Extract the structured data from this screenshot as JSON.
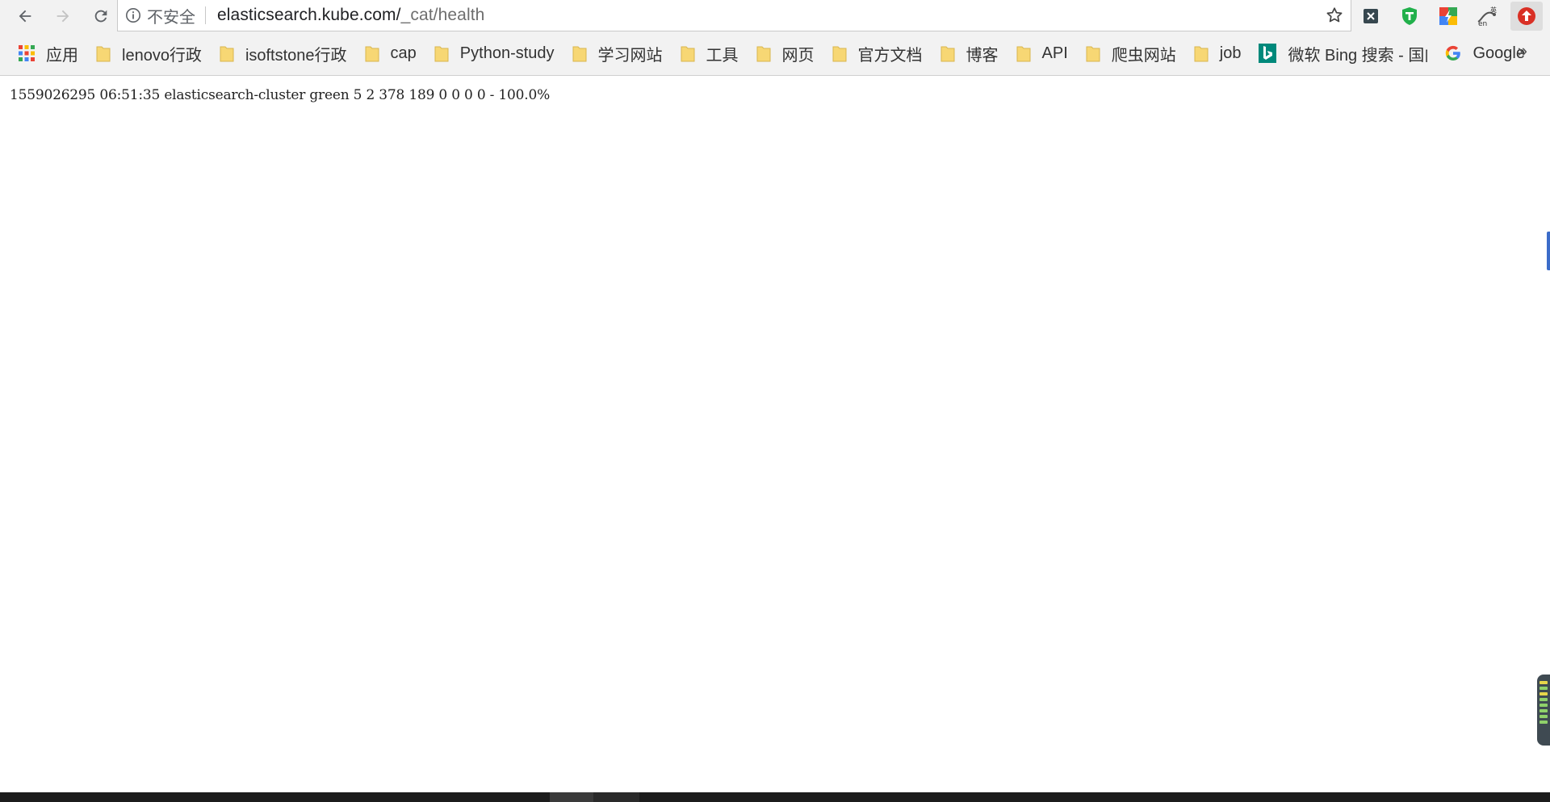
{
  "browser": {
    "security_label": "不安全",
    "url_host": "elasticsearch.kube.com/",
    "url_path": "_cat/health"
  },
  "extensions": [
    {
      "name": "x-extension-icon"
    },
    {
      "name": "t-shield-extension-icon"
    },
    {
      "name": "colorful-extension-icon"
    },
    {
      "name": "translate-en-extension-icon"
    },
    {
      "name": "upload-extension-icon"
    }
  ],
  "bookmarks": {
    "apps_label": "应用",
    "items": [
      "lenovo行政",
      "isoftstone行政",
      "cap",
      "Python-study",
      "学习网站",
      "工具",
      "网页",
      "官方文档",
      "博客",
      "API",
      "爬虫网站",
      "job"
    ],
    "bing_label": "微软 Bing 搜索 - 国内版",
    "google_label": "Google",
    "more_label": "»"
  },
  "content": {
    "health_line": "1559026295 06:51:35 elasticsearch-cluster green 5 2 378 189 0 0 0 0 - 100.0%"
  },
  "colors": {
    "folder": "#f7d774",
    "toolbar_bg": "#f2f2f2",
    "bing": "#00897b",
    "taskbar": "#1c1c1c"
  }
}
